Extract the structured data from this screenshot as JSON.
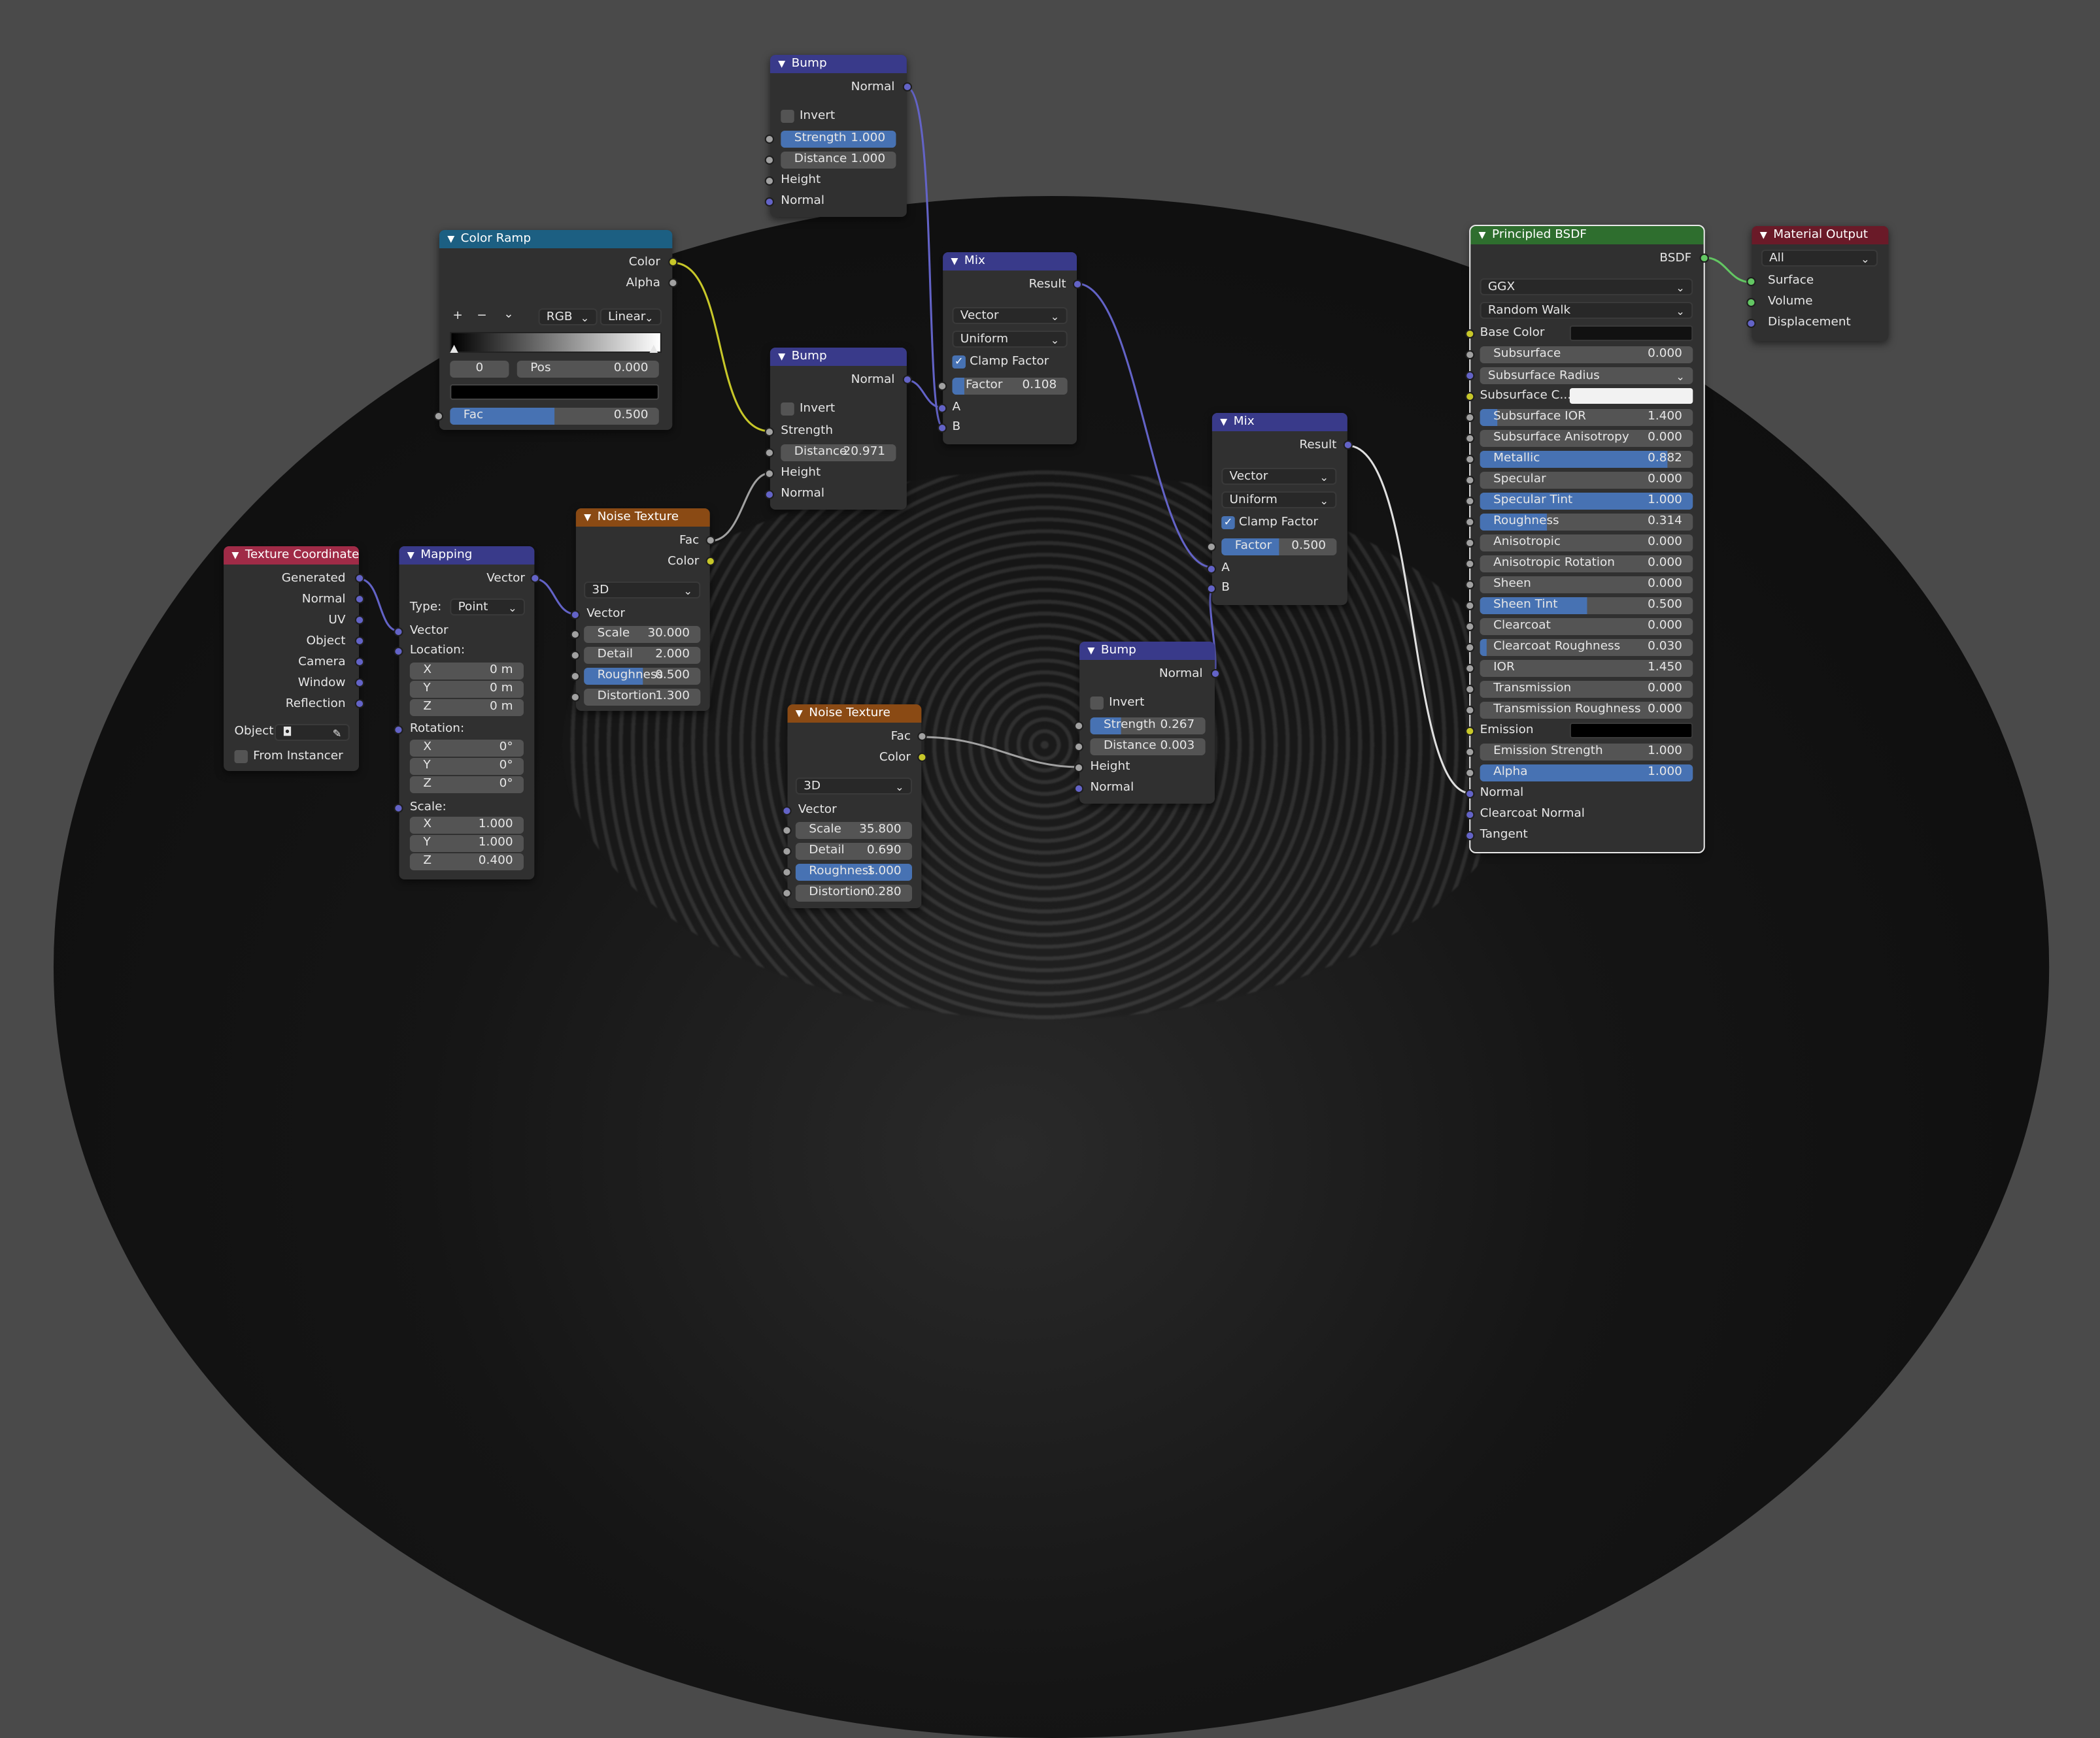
{
  "colors": {
    "texcoord": "#a02b47",
    "vector": "#393a8a",
    "texture": "#8a4a14",
    "converter": "#1c5f82",
    "shader": "#2e6e2e",
    "output": "#6a1a28",
    "wire": "#9a9a9a",
    "accent": "#4772b3",
    "sock_vec": "#6363c7",
    "sock_col": "#c7c729",
    "sock_val": "#a1a1a1",
    "sock_sh": "#63c763"
  },
  "texcoord": {
    "title": "Texture Coordinate",
    "outputs": [
      "Generated",
      "Normal",
      "UV",
      "Object",
      "Camera",
      "Window",
      "Reflection"
    ],
    "object_label": "Object:",
    "from_instancer": "From Instancer"
  },
  "mapping": {
    "title": "Mapping",
    "out": "Vector",
    "type_label": "Type:",
    "type_value": "Point",
    "vector_in": "Vector",
    "location": "Location:",
    "loc": [
      {
        "a": "X",
        "v": "0 m"
      },
      {
        "a": "Y",
        "v": "0 m"
      },
      {
        "a": "Z",
        "v": "0 m"
      }
    ],
    "rotation": "Rotation:",
    "rot": [
      {
        "a": "X",
        "v": "0°"
      },
      {
        "a": "Y",
        "v": "0°"
      },
      {
        "a": "Z",
        "v": "0°"
      }
    ],
    "scale": "Scale:",
    "scl": [
      {
        "a": "X",
        "v": "1.000"
      },
      {
        "a": "Y",
        "v": "1.000"
      },
      {
        "a": "Z",
        "v": "0.400"
      }
    ]
  },
  "colorramp": {
    "title": "Color Ramp",
    "out_color": "Color",
    "out_alpha": "Alpha",
    "plus": "+",
    "minus": "−",
    "menu": "⌄",
    "mode": "RGB",
    "interp": "Linear",
    "index": "0",
    "pos_label": "Pos",
    "pos_value": "0.000",
    "fac_label": "Fac",
    "fac_value": "0.500"
  },
  "noise1": {
    "title": "Noise Texture",
    "out_fac": "Fac",
    "out_color": "Color",
    "dim": "3D",
    "vector": "Vector",
    "fields": [
      {
        "l": "Scale",
        "v": "30.000"
      },
      {
        "l": "Detail",
        "v": "2.000"
      },
      {
        "l": "Roughness",
        "v": "0.500",
        "f": 0.5
      },
      {
        "l": "Distortion",
        "v": "1.300"
      }
    ]
  },
  "noise2": {
    "title": "Noise Texture",
    "out_fac": "Fac",
    "out_color": "Color",
    "dim": "3D",
    "vector": "Vector",
    "fields": [
      {
        "l": "Scale",
        "v": "35.800"
      },
      {
        "l": "Detail",
        "v": "0.690"
      },
      {
        "l": "Roughness",
        "v": "1.000",
        "f": 1.0
      },
      {
        "l": "Distortion",
        "v": "0.280"
      }
    ]
  },
  "bump1": {
    "title": "Bump",
    "out": "Normal",
    "invert": "Invert",
    "strength_l": "Strength",
    "strength_v": "1.000",
    "strength_f": 1.0,
    "dist_l": "Distance",
    "dist_v": "1.000",
    "height": "Height",
    "normal": "Normal"
  },
  "bump2": {
    "title": "Bump",
    "out": "Normal",
    "invert": "Invert",
    "strength": "Strength",
    "dist_l": "Distance",
    "dist_v": "20.971",
    "height": "Height",
    "normal": "Normal"
  },
  "bump3": {
    "title": "Bump",
    "out": "Normal",
    "invert": "Invert",
    "strength_l": "Strength",
    "strength_v": "0.267",
    "strength_f": 0.267,
    "dist_l": "Distance",
    "dist_v": "0.003",
    "height": "Height",
    "normal": "Normal"
  },
  "mix1": {
    "title": "Mix",
    "out": "Result",
    "dtype": "Vector",
    "mode": "Uniform",
    "clamp": "Clamp Factor",
    "factor_l": "Factor",
    "factor_v": "0.108",
    "factor_f": 0.108,
    "a": "A",
    "b": "B"
  },
  "mix2": {
    "title": "Mix",
    "out": "Result",
    "dtype": "Vector",
    "mode": "Uniform",
    "clamp": "Clamp Factor",
    "factor_l": "Factor",
    "factor_v": "0.500",
    "factor_f": 0.5,
    "a": "A",
    "b": "B"
  },
  "bsdf": {
    "title": "Principled BSDF",
    "out": "BSDF",
    "dist": "GGX",
    "sss": "Random Walk",
    "base_color": "Base Color",
    "subsurface": {
      "l": "Subsurface",
      "v": "0.000"
    },
    "ss_radius": "Subsurface Radius",
    "ss_color": "Subsurface C...",
    "fields": [
      {
        "l": "Subsurface IOR",
        "v": "1.400",
        "f": 0.08
      },
      {
        "l": "Subsurface Anisotropy",
        "v": "0.000",
        "f": 0
      },
      {
        "l": "Metallic",
        "v": "0.882",
        "f": 0.882
      },
      {
        "l": "Specular",
        "v": "0.000",
        "f": 0
      },
      {
        "l": "Specular Tint",
        "v": "1.000",
        "f": 1.0
      },
      {
        "l": "Roughness",
        "v": "0.314",
        "f": 0.314
      },
      {
        "l": "Anisotropic",
        "v": "0.000",
        "f": 0
      },
      {
        "l": "Anisotropic Rotation",
        "v": "0.000",
        "f": 0
      },
      {
        "l": "Sheen",
        "v": "0.000",
        "f": 0
      },
      {
        "l": "Sheen Tint",
        "v": "0.500",
        "f": 0.5
      },
      {
        "l": "Clearcoat",
        "v": "0.000",
        "f": 0
      },
      {
        "l": "Clearcoat Roughness",
        "v": "0.030",
        "f": 0.03
      },
      {
        "l": "IOR",
        "v": "1.450",
        "f": 0
      },
      {
        "l": "Transmission",
        "v": "0.000",
        "f": 0
      },
      {
        "l": "Transmission Roughness",
        "v": "0.000",
        "f": 0
      }
    ],
    "emission": "Emission",
    "emission_strength": {
      "l": "Emission Strength",
      "v": "1.000"
    },
    "alpha": {
      "l": "Alpha",
      "v": "1.000",
      "f": 1.0
    },
    "normal": "Normal",
    "cc_normal": "Clearcoat Normal",
    "tangent": "Tangent"
  },
  "output": {
    "title": "Material Output",
    "target": "All",
    "surface": "Surface",
    "volume": "Volume",
    "displacement": "Displacement"
  }
}
